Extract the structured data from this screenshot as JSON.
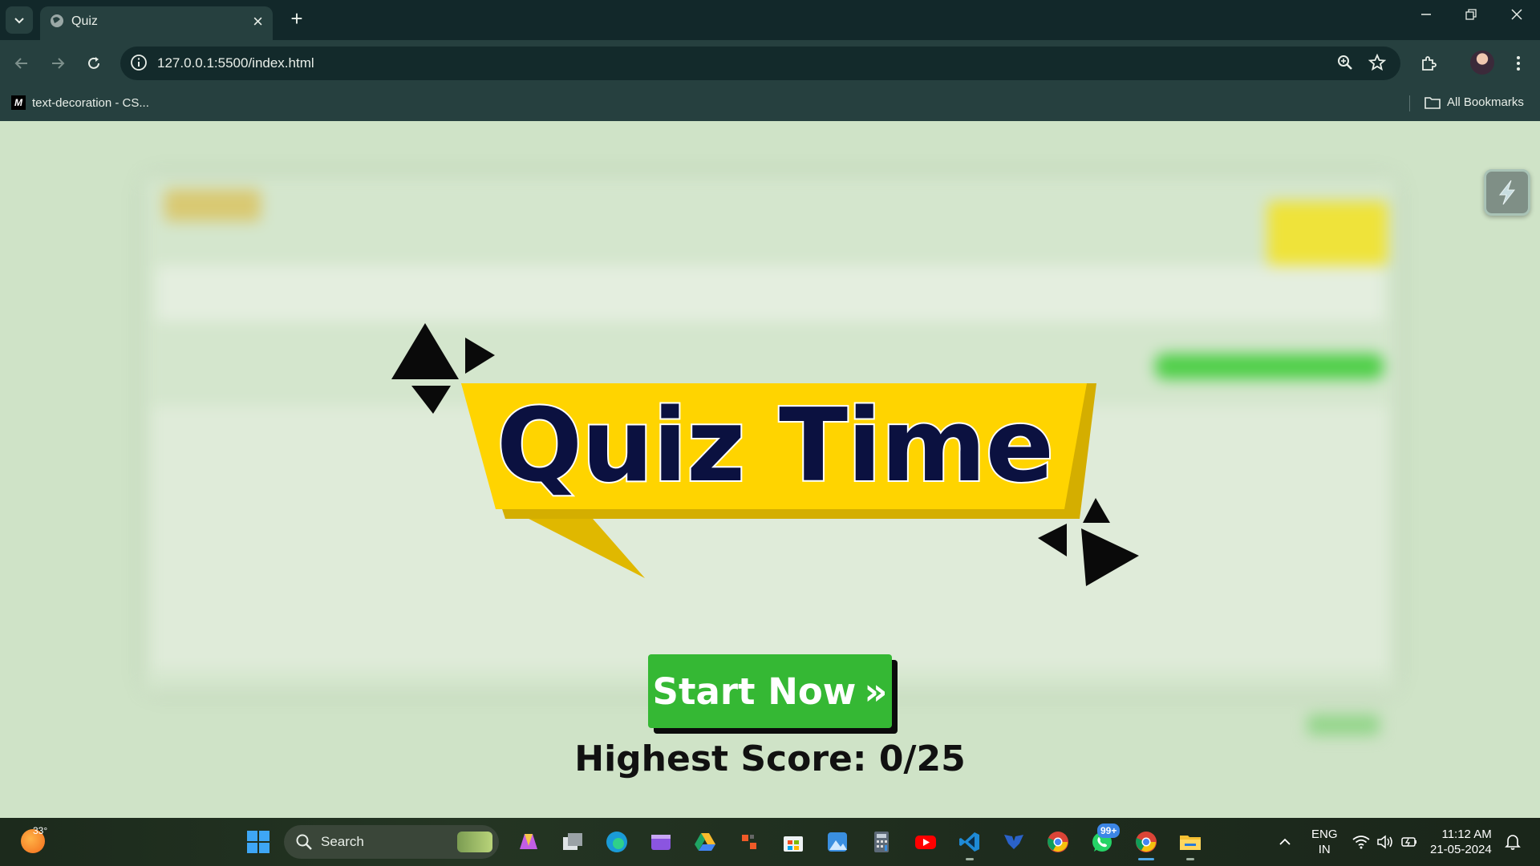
{
  "browser": {
    "tab_title": "Quiz",
    "new_tab_symbol": "+",
    "tab_close_symbol": "×",
    "url": "127.0.0.1:5500/index.html",
    "bookmarks": [
      {
        "label": "text-decoration - CS...",
        "icon": "mdn-icon"
      }
    ],
    "all_bookmarks_label": "All Bookmarks"
  },
  "page": {
    "banner_title": "Quiz Time",
    "start_button_label": "Start Now",
    "start_button_icon": "»",
    "highest_score": "Highest Score: 0/25"
  },
  "colors": {
    "banner_yellow": "#FFD400",
    "banner_shadow": "#D4AE00",
    "title_navy": "#0B1140",
    "start_green": "#35B834",
    "page_bg": "#CFE3C7"
  },
  "taskbar": {
    "weather_temp": "33°",
    "search_placeholder": "Search",
    "notification_badge": "99+",
    "language_line1": "ENG",
    "language_line2": "IN",
    "time": "11:12 AM",
    "date": "21-05-2024"
  }
}
